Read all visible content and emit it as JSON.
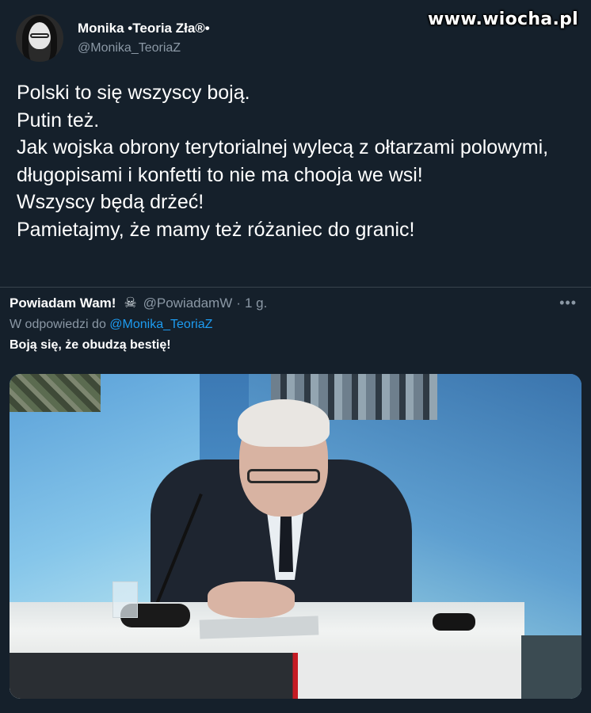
{
  "watermark": "www.wiocha.pl",
  "tweet": {
    "display_name": "Monika •Teoria Zła®•",
    "handle": "@Monika_TeoriaZ",
    "lines": [
      "Polski to się wszyscy boją.",
      "Putin też.",
      "Jak wojska obrony terytorialnej wylecą z ołtarzami polowymi, długopisami i konfetti to nie ma chooja we wsi!",
      "Wszyscy będą drżeć!",
      "Pamietajmy, że mamy też różaniec do granic!"
    ]
  },
  "reply": {
    "display_name": "Powiadam Wam!",
    "emoji": "☠",
    "handle": "@PowiadamW",
    "separator": "·",
    "time": "1 g.",
    "more": "•••",
    "reply_prefix": "W odpowiedzi do",
    "reply_mention": "@Monika_TeoriaZ",
    "text": "Boją się, że obudzą bestię!"
  },
  "icons": {
    "avatar": "avatar-photo",
    "skull": "skull-crossbones-icon",
    "more": "more-options-icon"
  },
  "colors": {
    "background": "#15202b",
    "secondary_text": "#8b98a5",
    "link": "#1d9bf0"
  }
}
